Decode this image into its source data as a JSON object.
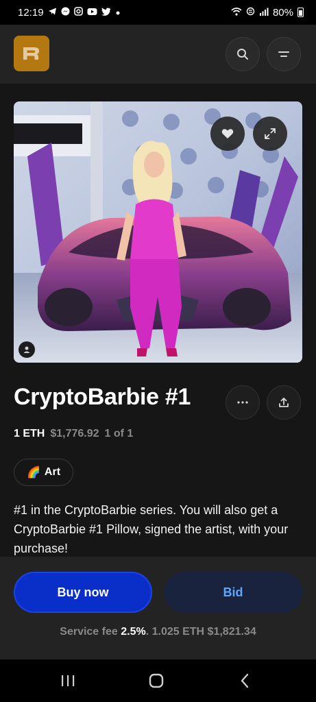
{
  "status_bar": {
    "time": "12:19",
    "notification_icons": [
      "telegram-icon",
      "messenger-icon",
      "instagram-icon",
      "youtube-icon",
      "twitter-icon",
      "dot-icon"
    ],
    "system_icons": [
      "wifi-icon",
      "sync-icon",
      "signal-icon"
    ],
    "battery": "80%"
  },
  "header": {
    "logo_icon": "rarible-logo",
    "search_icon": "search-icon",
    "menu_icon": "menu-icon"
  },
  "nft": {
    "title": "CryptoBarbie #1",
    "price_eth": "1 ETH",
    "price_usd": "$1,776.92",
    "edition": "1 of 1",
    "tag": {
      "emoji": "🌈",
      "label": "Art"
    },
    "description": "#1 in the CryptoBarbie series.  You will also get a CryptoBarbie #1  Pillow, signed the artist, with your purchase!"
  },
  "actions": {
    "buy_label": "Buy now",
    "bid_label": "Bid",
    "fee_label": "Service fee",
    "fee_percent": "2.5%",
    "fee_separator": ".",
    "total_eth": "1.025 ETH",
    "total_usd": "$1,821.34"
  },
  "colors": {
    "accent_blue": "#0a2fc8",
    "bid_text": "#5fa6ff",
    "logo_bg": "#b3780f"
  }
}
